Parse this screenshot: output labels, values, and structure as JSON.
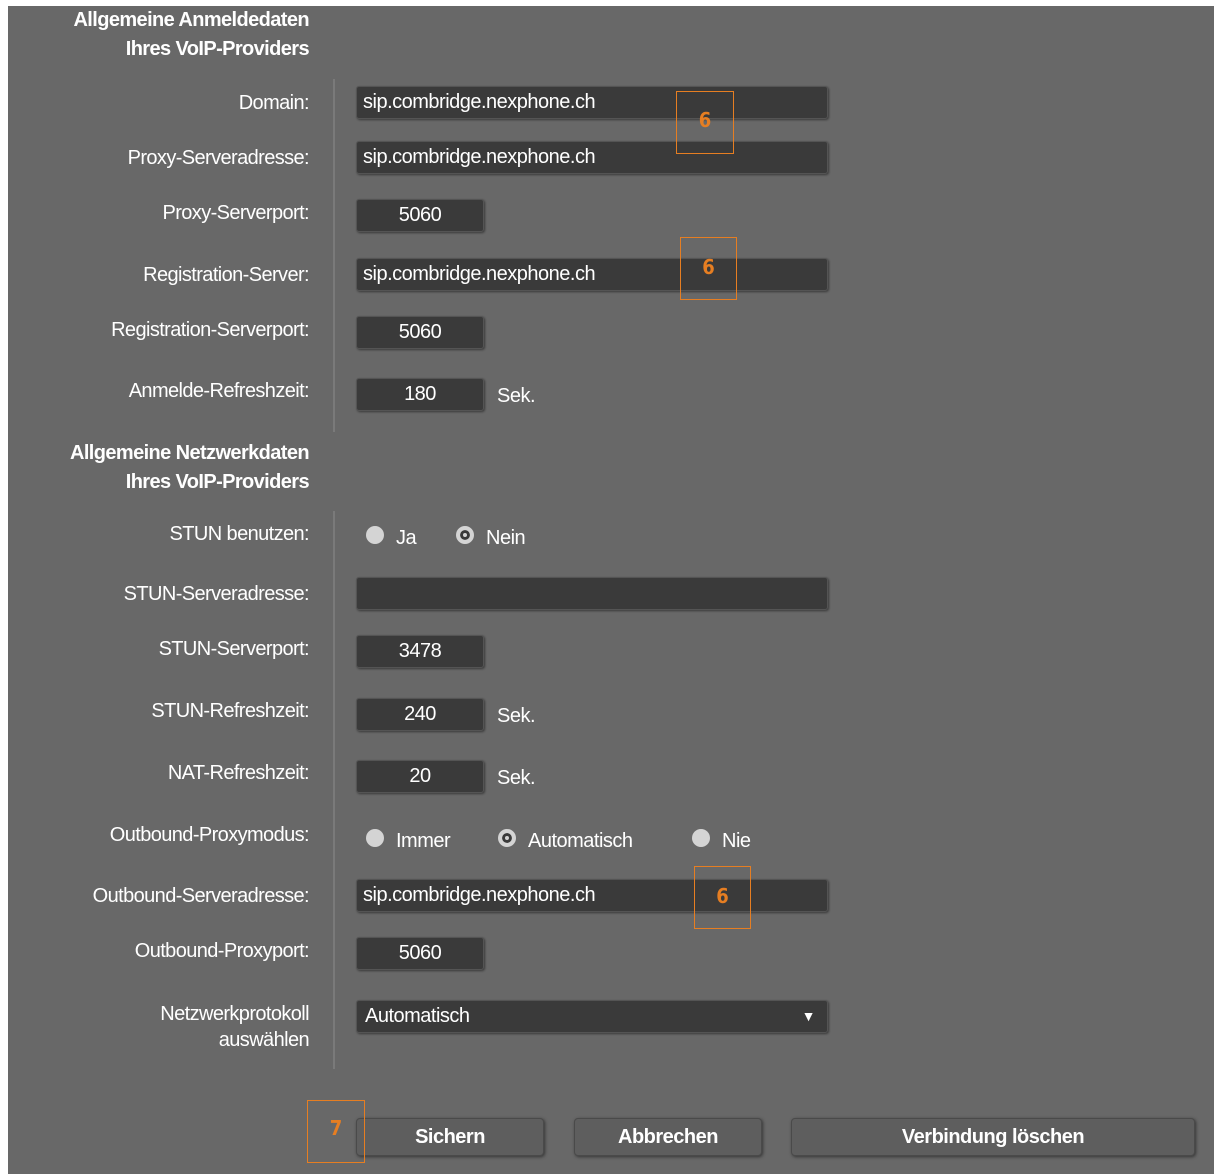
{
  "sections": {
    "login_title_1": "Allgemeine Anmeldedaten",
    "login_title_2": "Ihres VoIP-Providers",
    "network_title_1": "Allgemeine Netzwerkdaten",
    "network_title_2": "Ihres VoIP-Providers"
  },
  "login": {
    "domain_label": "Domain:",
    "domain_value": "sip.combridge.nexphone.ch",
    "proxy_server_label": "Proxy-Serveradresse:",
    "proxy_server_value": "sip.combridge.nexphone.ch",
    "proxy_port_label": "Proxy-Serverport:",
    "proxy_port_value": "5060",
    "registration_server_label": "Registration-Server:",
    "registration_server_value": "sip.combridge.nexphone.ch",
    "registration_port_label": "Registration-Serverport:",
    "registration_port_value": "5060",
    "refresh_label": "Anmelde-Refreshzeit:",
    "refresh_value": "180",
    "refresh_unit": "Sek."
  },
  "network": {
    "stun_use_label": "STUN benutzen:",
    "stun_yes": "Ja",
    "stun_no": "Nein",
    "stun_selected": "Nein",
    "stun_server_label": "STUN-Serveradresse:",
    "stun_server_value": "",
    "stun_port_label": "STUN-Serverport:",
    "stun_port_value": "3478",
    "stun_refresh_label": "STUN-Refreshzeit:",
    "stun_refresh_value": "240",
    "stun_refresh_unit": "Sek.",
    "nat_refresh_label": "NAT-Refreshzeit:",
    "nat_refresh_value": "20",
    "nat_refresh_unit": "Sek.",
    "outbound_mode_label": "Outbound-Proxymodus:",
    "outbound_always": "Immer",
    "outbound_auto": "Automatisch",
    "outbound_never": "Nie",
    "outbound_selected": "Automatisch",
    "outbound_server_label": "Outbound-Serveradresse:",
    "outbound_server_value": "sip.combridge.nexphone.ch",
    "outbound_port_label": "Outbound-Proxyport:",
    "outbound_port_value": "5060",
    "protocol_label_1": "Netzwerkprotokoll",
    "protocol_label_2": "auswählen",
    "protocol_value": "Automatisch"
  },
  "buttons": {
    "save": "Sichern",
    "cancel": "Abbrechen",
    "delete": "Verbindung löschen"
  },
  "markers": {
    "domain": "6",
    "registration": "6",
    "outbound": "6",
    "save": "7",
    "color": "#e67e22"
  },
  "colors": {
    "background": "#686868",
    "field": "#3a3a3a",
    "text": "#ffffff"
  }
}
